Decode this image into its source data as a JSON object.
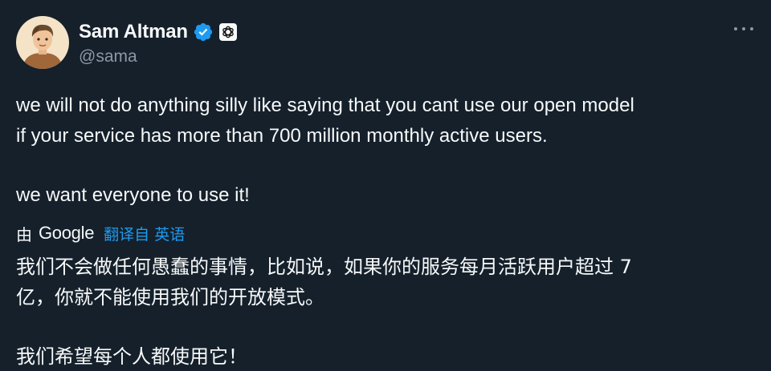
{
  "author": {
    "display_name": "Sam Altman",
    "handle": "@sama",
    "avatar_icon": "avatar-illustration",
    "verified_icon": "verified-badge-icon",
    "affiliation_icon": "openai-logo-icon"
  },
  "menu": {
    "icon": "more-horizontal-icon"
  },
  "tweet": {
    "lines": [
      "we will not do anything silly like saying that you cant use our open model",
      "if your service has more than 700 million monthly active users."
    ],
    "line_3": "we want everyone to use it!"
  },
  "translation": {
    "by_label": "由",
    "provider": "Google",
    "link": "翻译自 英语",
    "lines": [
      "我们不会做任何愚蠢的事情，比如说，如果你的服务每月活跃用户超过 7",
      "亿，你就不能使用我们的开放模式。"
    ],
    "line_3": "我们希望每个人都使用它！"
  },
  "colors": {
    "background": "#15202b",
    "text": "#f7f9f9",
    "secondary": "#8b98a5",
    "accent": "#1d9bf0"
  }
}
